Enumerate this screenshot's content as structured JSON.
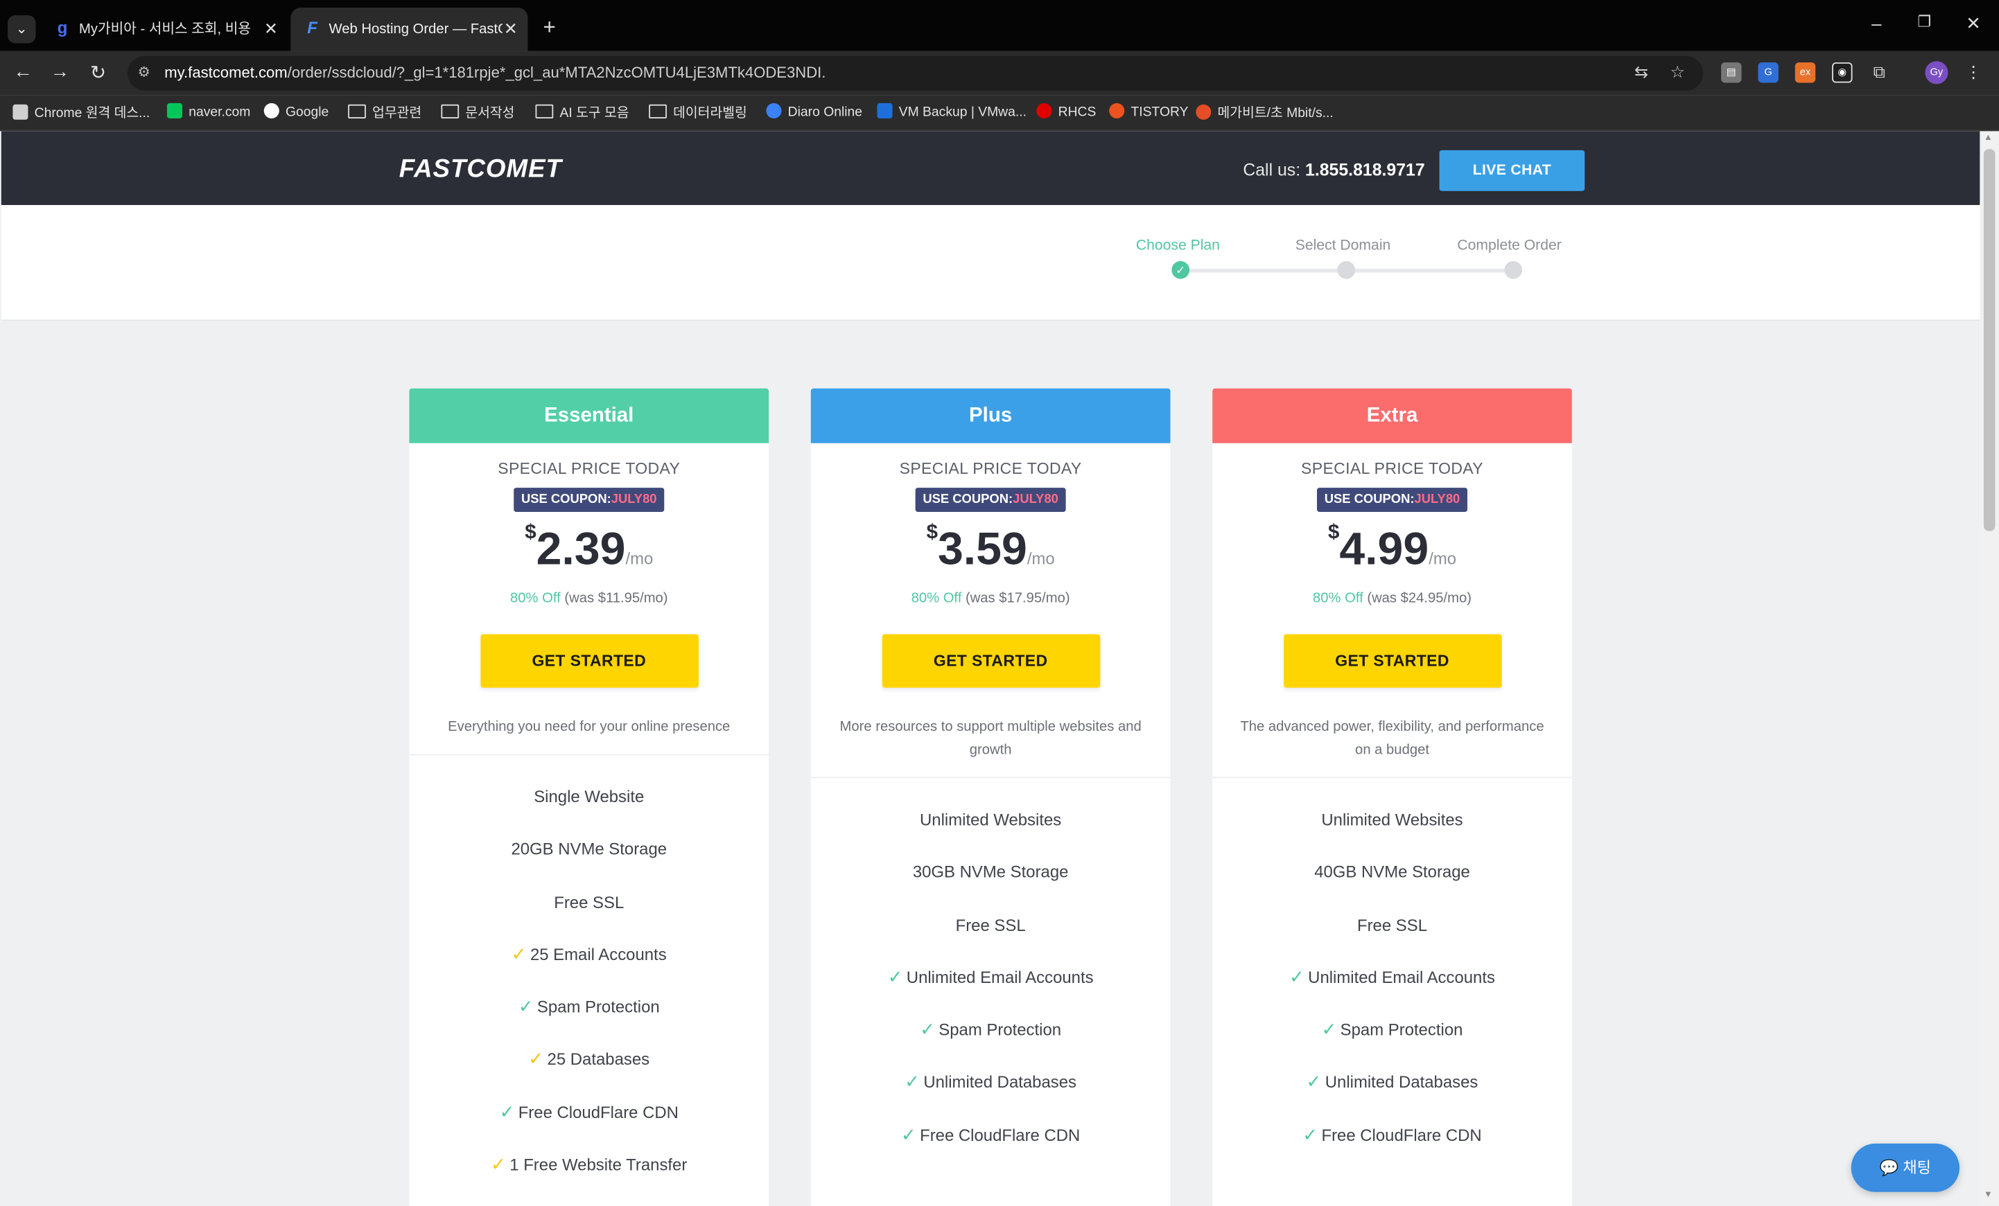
{
  "browser": {
    "tabs": [
      {
        "title": "My가비아 - 서비스 조회, 비용",
        "favicon": "g",
        "active": false
      },
      {
        "title": "Web Hosting Order — FastComet",
        "favicon": "F",
        "active": true
      }
    ],
    "url_host": "my.fastcomet.com",
    "url_path": "/order/ssdcloud/?_gl=1*181rpje*_gcl_au*MTA2NzcOMTU4LjE3MTk4ODE3NDI.",
    "bookmarks": [
      {
        "label": "Chrome 원격 데스...",
        "type": "site",
        "color": "#d0d0d0"
      },
      {
        "label": "naver.com",
        "type": "site",
        "color": "#03c75a"
      },
      {
        "label": "Google",
        "type": "site",
        "color": "#ffffff"
      },
      {
        "label": "업무관련",
        "type": "folder"
      },
      {
        "label": "문서작성",
        "type": "folder"
      },
      {
        "label": "AI 도구 모음",
        "type": "folder"
      },
      {
        "label": "데이터라벨링",
        "type": "folder"
      },
      {
        "label": "Diaro Online",
        "type": "site",
        "color": "#3b82f6"
      },
      {
        "label": "VM Backup | VMwa...",
        "type": "site",
        "color": "#1e6fd9"
      },
      {
        "label": "RHCS",
        "type": "site",
        "color": "#e00000"
      },
      {
        "label": "TISTORY",
        "type": "site",
        "color": "#eb531f"
      },
      {
        "label": "메가비트/초 Mbit/s...",
        "type": "site",
        "color": "#e44d26"
      }
    ],
    "profile_initials": "Gy"
  },
  "header": {
    "logo": "FASTCOMET",
    "call_label": "Call us:",
    "phone": "1.855.818.9717",
    "live_chat": "LIVE CHAT"
  },
  "steps": [
    {
      "label": "Choose Plan",
      "active": true
    },
    {
      "label": "Select Domain",
      "active": false
    },
    {
      "label": "Complete Order",
      "active": false
    }
  ],
  "plans": [
    {
      "name": "Essential",
      "color": "#52cfa7",
      "special": "SPECIAL PRICE TODAY",
      "coupon_label": "USE COUPON:",
      "coupon_code": "JULY80",
      "currency": "$",
      "price": "2.39",
      "per": "/mo",
      "off": "80% Off",
      "was": "(was $11.95/mo)",
      "cta": "GET STARTED",
      "description": "Everything you need for your online presence",
      "features": [
        {
          "text": "Single Website",
          "check": "none"
        },
        {
          "text": "20GB NVMe Storage",
          "check": "none"
        },
        {
          "text": "Free SSL",
          "check": "none"
        },
        {
          "text": "25 Email Accounts",
          "check": "gold"
        },
        {
          "text": "Spam Protection",
          "check": "green"
        },
        {
          "text": "25 Databases",
          "check": "gold"
        },
        {
          "text": "Free CloudFlare CDN",
          "check": "green"
        },
        {
          "text": "1 Free Website Transfer",
          "check": "gold"
        }
      ]
    },
    {
      "name": "Plus",
      "color": "#3ba0e8",
      "special": "SPECIAL PRICE TODAY",
      "coupon_label": "USE COUPON:",
      "coupon_code": "JULY80",
      "currency": "$",
      "price": "3.59",
      "per": "/mo",
      "off": "80% Off",
      "was": "(was $17.95/mo)",
      "cta": "GET STARTED",
      "description": "More resources to support multiple websites and growth",
      "features": [
        {
          "text": "Unlimited Websites",
          "check": "none"
        },
        {
          "text": "30GB NVMe Storage",
          "check": "none"
        },
        {
          "text": "Free SSL",
          "check": "none"
        },
        {
          "text": "Unlimited Email Accounts",
          "check": "green"
        },
        {
          "text": "Spam Protection",
          "check": "green"
        },
        {
          "text": "Unlimited Databases",
          "check": "green"
        },
        {
          "text": "Free CloudFlare CDN",
          "check": "green"
        }
      ]
    },
    {
      "name": "Extra",
      "color": "#fb6d6d",
      "special": "SPECIAL PRICE TODAY",
      "coupon_label": "USE COUPON:",
      "coupon_code": "JULY80",
      "currency": "$",
      "price": "4.99",
      "per": "/mo",
      "off": "80% Off",
      "was": "(was $24.95/mo)",
      "cta": "GET STARTED",
      "description": "The advanced power, flexibility, and performance on a budget",
      "features": [
        {
          "text": "Unlimited Websites",
          "check": "none"
        },
        {
          "text": "40GB NVMe Storage",
          "check": "none"
        },
        {
          "text": "Free SSL",
          "check": "none"
        },
        {
          "text": "Unlimited Email Accounts",
          "check": "green"
        },
        {
          "text": "Spam Protection",
          "check": "green"
        },
        {
          "text": "Unlimited Databases",
          "check": "green"
        },
        {
          "text": "Free CloudFlare CDN",
          "check": "green"
        }
      ]
    }
  ],
  "chat_widget": {
    "label": "채팅"
  }
}
